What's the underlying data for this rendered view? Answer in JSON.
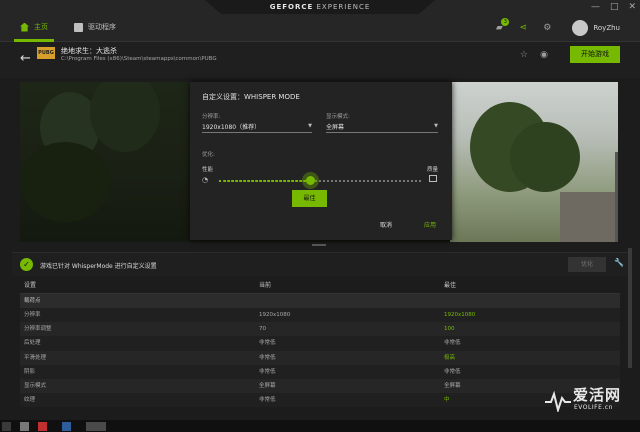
{
  "window": {
    "brand_bold": "GEFORCE",
    "brand_rest": " EXPERIENCE",
    "controls": [
      "—",
      "□",
      "✕"
    ]
  },
  "nav": {
    "home": "主页",
    "drivers": "驱动程序"
  },
  "toolbar": {
    "notification_count": "3",
    "user_name": "RoyZhu"
  },
  "game": {
    "logo_text": "PUBG",
    "title": "绝地求生：大逃杀",
    "path": "C:\\Program Files (x86)\\Steam\\steamapps\\common\\PUBG",
    "start_button": "开始游戏"
  },
  "dialog": {
    "title": "自定义设置：WHISPER MODE",
    "resolution_label": "分辨率:",
    "resolution_value": "1920x1080（推荐）",
    "display_mode_label": "显示模式:",
    "display_mode_value": "全屏幕",
    "optimize_label": "优化:",
    "perf_label": "性能",
    "quality_label": "质量",
    "best_button": "最佳",
    "cancel": "取消",
    "apply": "应用"
  },
  "status": {
    "text": "游戏已针对 WhisperMode 进行自定义设置",
    "optimize_button": "优化"
  },
  "table": {
    "headers": [
      "设置",
      "当前",
      "最佳"
    ],
    "section": "载荷点",
    "rows": [
      {
        "setting": "分辨率",
        "current": "1920x1080",
        "best": "1920x1080",
        "best_green": true
      },
      {
        "setting": "分辨率调整",
        "current": "70",
        "best": "100",
        "best_green": true
      },
      {
        "setting": "后处理",
        "current": "非常低",
        "best": "非常低",
        "best_green": false
      },
      {
        "setting": "平滑处理",
        "current": "非常低",
        "best": "极高",
        "best_green": true
      },
      {
        "setting": "阴影",
        "current": "非常低",
        "best": "非常低",
        "best_green": false
      },
      {
        "setting": "显示模式",
        "current": "全屏幕",
        "best": "全屏幕",
        "best_green": false
      },
      {
        "setting": "纹理",
        "current": "非常低",
        "best": "中",
        "best_green": true
      }
    ]
  },
  "watermark": {
    "title": "爱活网",
    "subtitle": "EVOLIFE.cn"
  }
}
